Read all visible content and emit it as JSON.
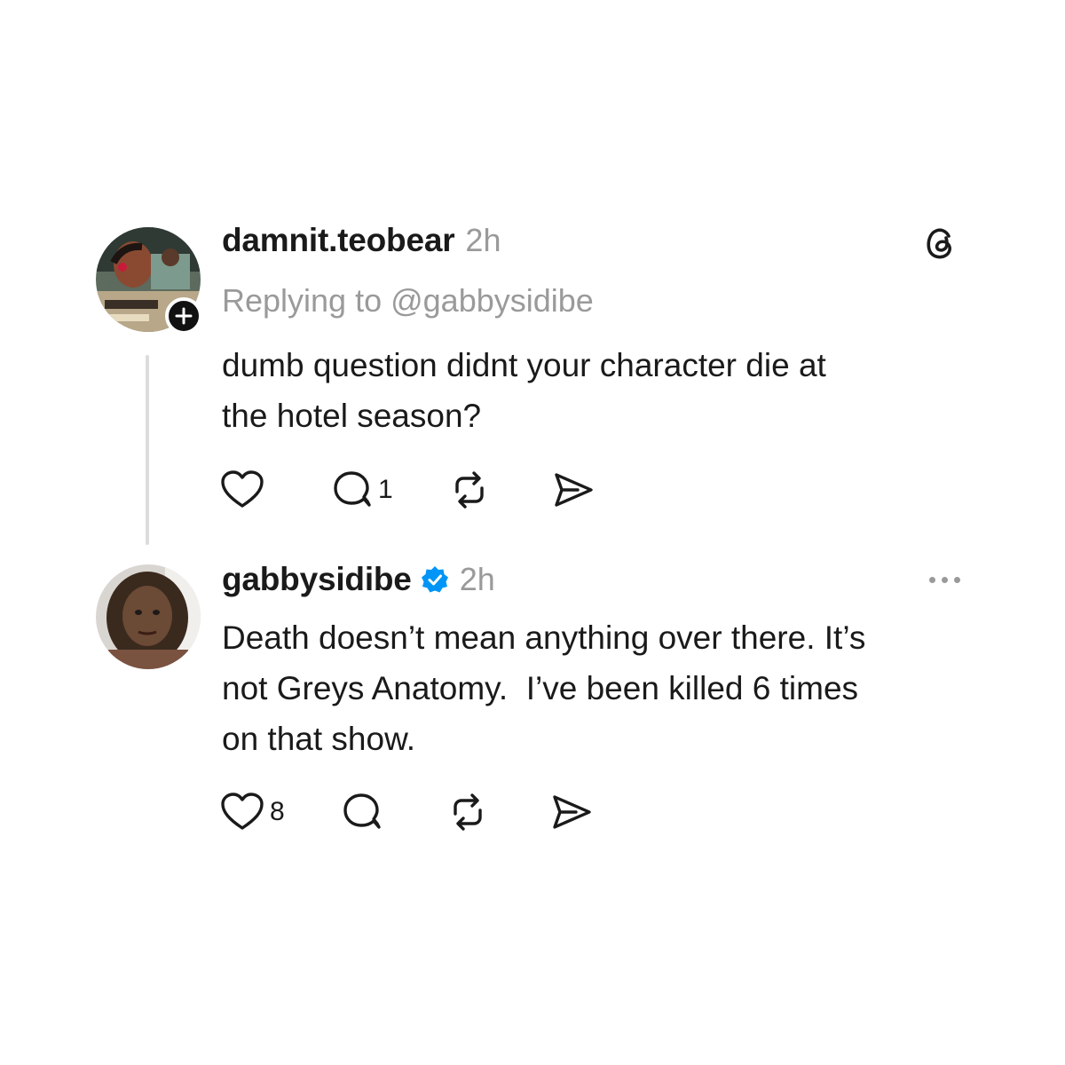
{
  "posts": [
    {
      "username": "damnit.teobear",
      "timestamp": "2h",
      "reply_to": "Replying to @gabbysidibe",
      "text": "dumb question didnt your character die at\nthe hotel season?",
      "like_count": "",
      "reply_count": "1",
      "repost_count": "",
      "avatar_icon": "user-avatar",
      "badge_icon": "plus-icon"
    },
    {
      "username": "gabbysidibe",
      "verified": true,
      "timestamp": "2h",
      "text": "Death doesn’t mean anything over there. It’s\nnot Greys Anatomy.  I’ve been killed 6 times\non that show.",
      "like_count": "8",
      "reply_count": "",
      "repost_count": "",
      "avatar_icon": "user-avatar"
    }
  ],
  "icons": {
    "brand": "threads-logo-icon",
    "like": "heart-icon",
    "reply": "comment-icon",
    "repost": "repost-icon",
    "share": "send-icon",
    "more": "more-options-icon",
    "verified": "verified-badge-icon"
  },
  "colors": {
    "text": "#1a1a1a",
    "muted": "#9a9a9a",
    "verified_blue": "#0095f6",
    "thread_line": "#dcdcdc"
  }
}
